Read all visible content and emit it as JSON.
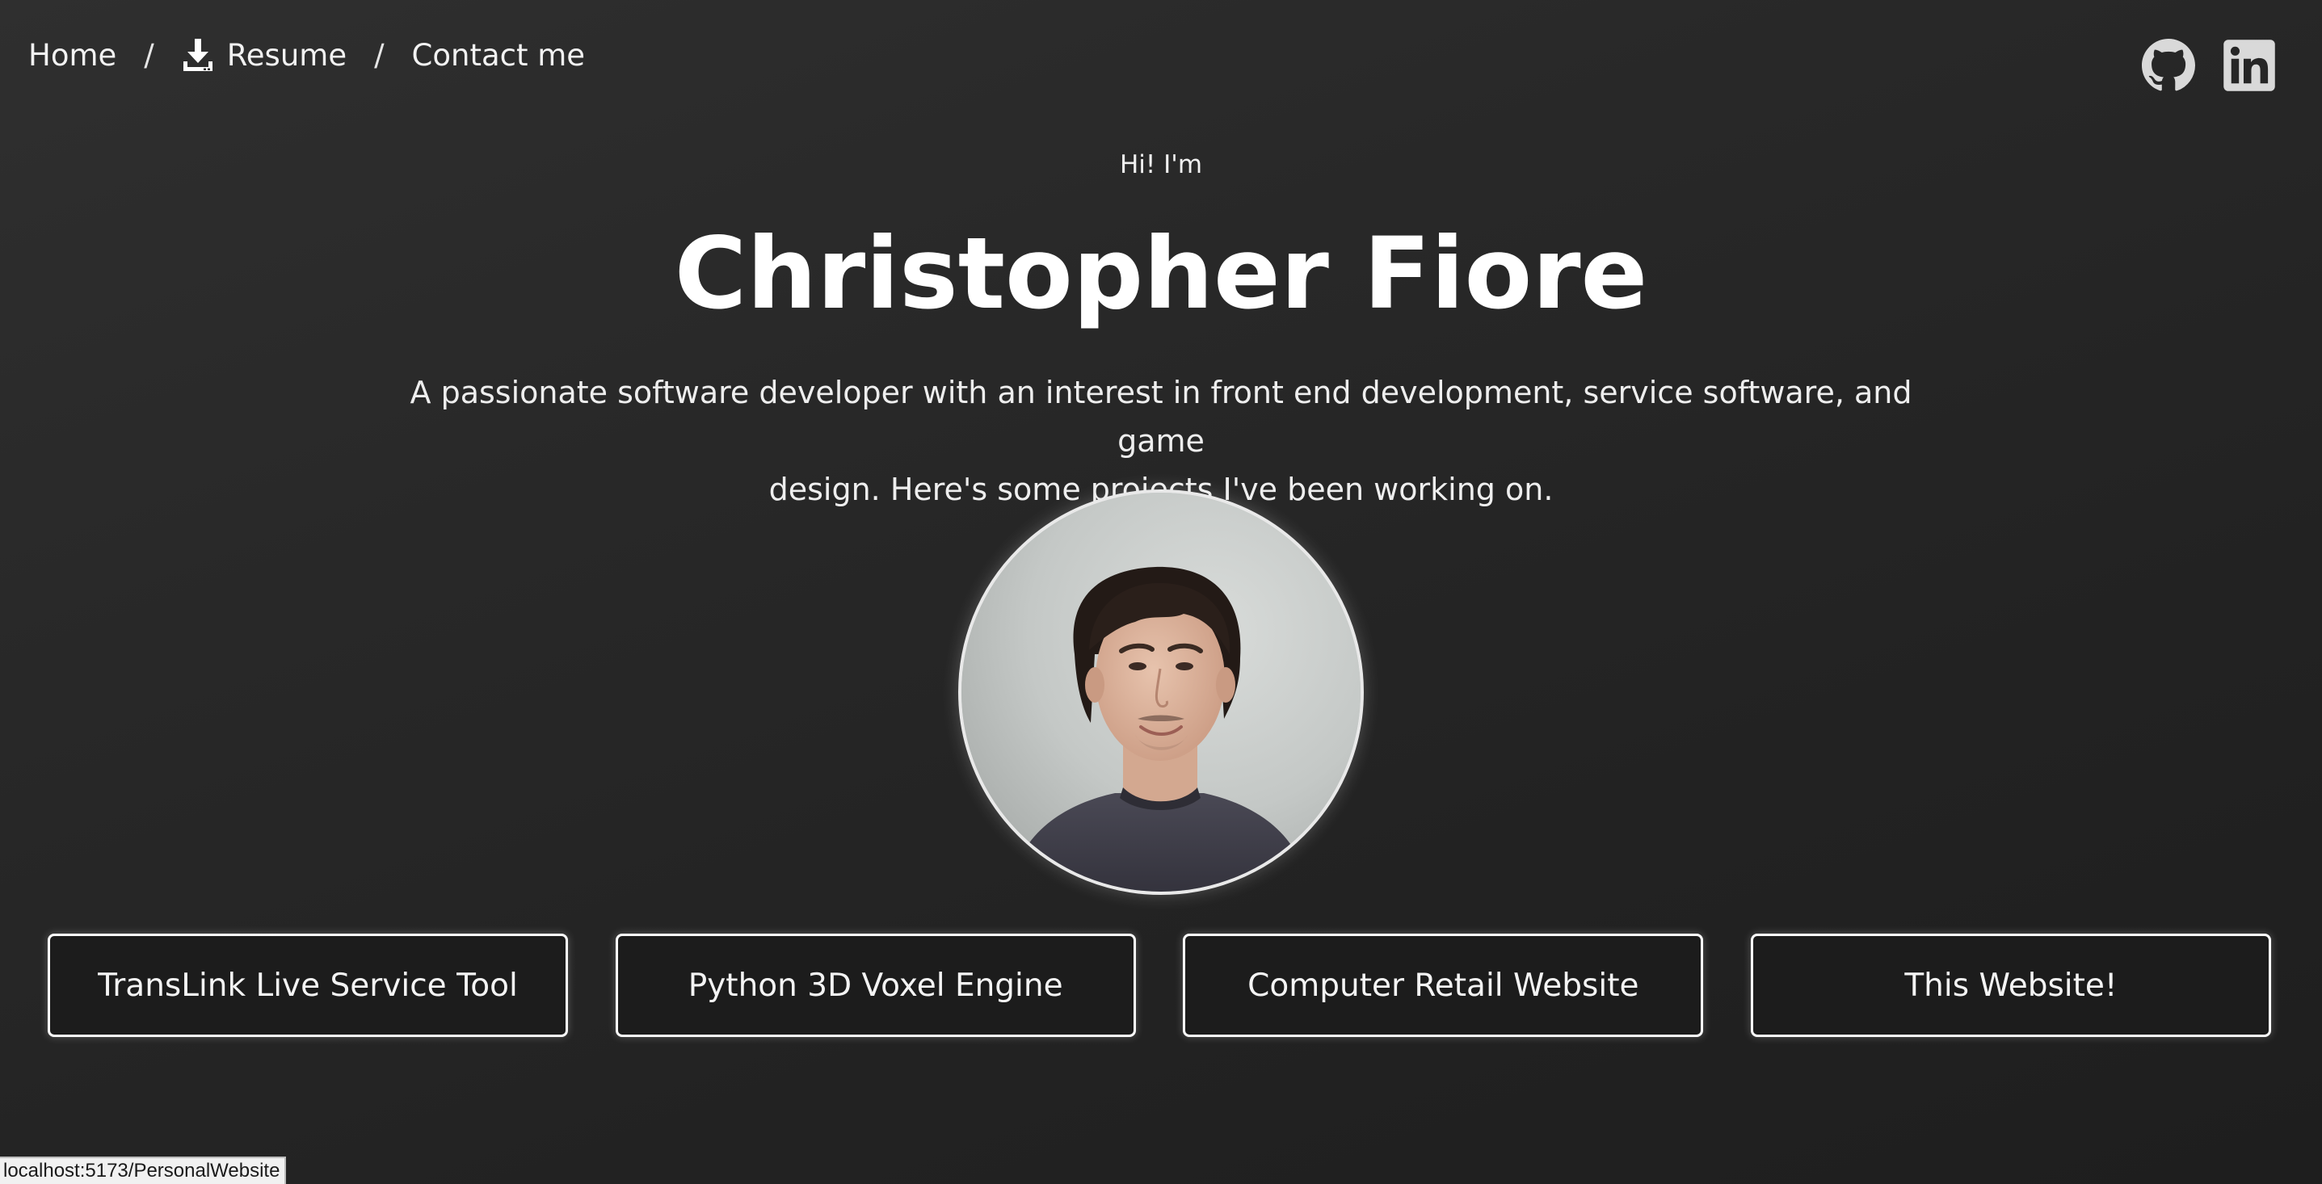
{
  "nav": {
    "home": "Home",
    "separator": "/",
    "resume": "Resume",
    "contact": "Contact me",
    "resume_icon": "download-icon"
  },
  "social": {
    "github_icon": "github-icon",
    "linkedin_icon": "linkedin-icon",
    "icon_color": "#d9d9d9"
  },
  "hero": {
    "greeting": "Hi! I'm",
    "name": "Christopher Fiore",
    "tagline_line1": "A passionate software developer with an interest in front end development, service software, and game",
    "tagline_line2": "design. Here's some projects I've been working on."
  },
  "projects": [
    {
      "label": "TransLink Live Service Tool"
    },
    {
      "label": "Python 3D Voxel Engine"
    },
    {
      "label": "Computer Retail Website"
    },
    {
      "label": "This Website!"
    }
  ],
  "status_bar": {
    "url": "localhost:5173/PersonalWebsite"
  },
  "colors": {
    "background": "#262626",
    "text": "#ffffff",
    "button_border": "#ffffff",
    "button_background": "#1c1c1c"
  }
}
